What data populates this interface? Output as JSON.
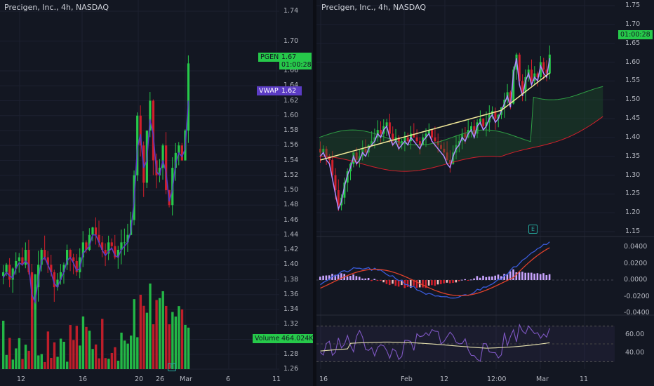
{
  "left_chart": {
    "title": "Precigen, Inc., 4h, NASDAQ",
    "y_ticks": [
      "1.74",
      "1.70",
      "1.66",
      "1.64",
      "1.62",
      "1.60",
      "1.58",
      "1.56",
      "1.54",
      "1.52",
      "1.50",
      "1.48",
      "1.46",
      "1.44",
      "1.42",
      "1.40",
      "1.38",
      "1.36",
      "1.34",
      "1.32",
      "1.30",
      "1.28",
      "1.26"
    ],
    "x_ticks": [
      "12",
      "16",
      "20",
      "26",
      "Mar",
      "6",
      "11"
    ],
    "symbol_tag": "PGEN",
    "price_tag": "1.67",
    "countdown": "01:00:28",
    "vwap_label": "VWAP",
    "vwap_value": "1.62",
    "volume_label": "Volume",
    "volume_value": "464.024K",
    "earnings_marker": "E"
  },
  "right_chart": {
    "title": "Precigen, Inc., 4h, NASDAQ",
    "y_ticks": [
      "1.75",
      "1.70",
      "1.65",
      "1.60",
      "1.55",
      "1.50",
      "1.45",
      "1.40",
      "1.35",
      "1.30",
      "1.25",
      "1.20",
      "1.15"
    ],
    "countdown": "01:00:28",
    "macd_ticks": [
      "0.0400",
      "0.0200",
      "0.0000",
      "-0.0200",
      "-0.0400"
    ],
    "rsi_ticks": [
      "60.00",
      "40.00"
    ],
    "x_ticks": [
      "16",
      "Feb",
      "12",
      "12:00",
      "Mar",
      "11"
    ],
    "earnings_marker": "E"
  },
  "colors": {
    "background": "#131722",
    "up": "#26c94a",
    "down": "#d11f2b",
    "vwap": "#5b3cc4",
    "macd_line": "#3a5bd9",
    "signal_line": "#e0412a",
    "rsi_line": "#7e57c2"
  }
}
